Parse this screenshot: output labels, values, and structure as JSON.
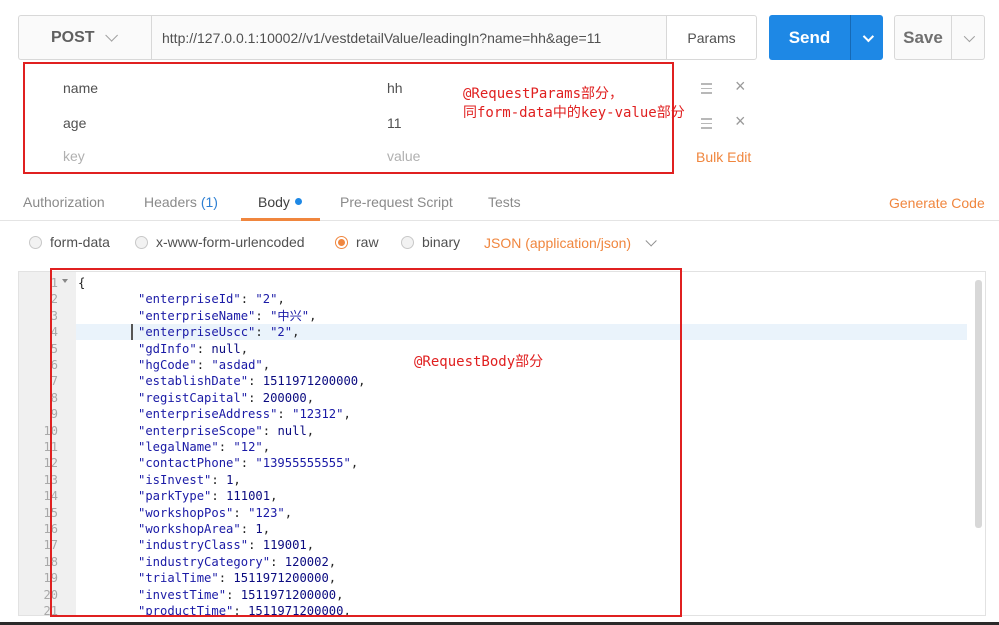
{
  "request": {
    "method": "POST",
    "url": "http://127.0.0.1:10002//v1/vestdetailValue/leadingIn?name=hh&age=11",
    "params_button": "Params",
    "send_button": "Send",
    "save_button": "Save"
  },
  "params": {
    "rows": [
      {
        "key": "name",
        "value": "hh"
      },
      {
        "key": "age",
        "value": "11"
      }
    ],
    "placeholder": {
      "key": "key",
      "value": "value"
    },
    "bulk_edit": "Bulk Edit"
  },
  "annotations": {
    "params_note_line1": "@RequestParams部分，",
    "params_note_line2": "同form-data中的key-value部分",
    "body_note": "@RequestBody部分"
  },
  "tabs": {
    "authorization": "Authorization",
    "headers": "Headers",
    "headers_count": "(1)",
    "body": "Body",
    "prerequest": "Pre-request Script",
    "tests": "Tests",
    "generate_code": "Generate Code",
    "active": "Body"
  },
  "body_options": {
    "form_data": "form-data",
    "urlencoded": "x-www-form-urlencoded",
    "raw": "raw",
    "binary": "binary",
    "selected": "raw",
    "content_type": "JSON (application/json)"
  },
  "editor": {
    "highlighted_line": 4,
    "lines": [
      {
        "n": "1",
        "key": "",
        "val": "{",
        "vtype": "punc"
      },
      {
        "n": "2",
        "key": "\"enterpriseId\"",
        "val": "\"2\"",
        "vtype": "str"
      },
      {
        "n": "3",
        "key": "\"enterpriseName\"",
        "val": "\"中兴\"",
        "vtype": "str"
      },
      {
        "n": "4",
        "key": "\"enterpriseUscc\"",
        "val": "\"2\"",
        "vtype": "str"
      },
      {
        "n": "5",
        "key": "\"gdInfo\"",
        "val": "null",
        "vtype": "num"
      },
      {
        "n": "6",
        "key": "\"hgCode\"",
        "val": "\"asdad\"",
        "vtype": "str"
      },
      {
        "n": "7",
        "key": "\"establishDate\"",
        "val": "1511971200000",
        "vtype": "num"
      },
      {
        "n": "8",
        "key": "\"registCapital\"",
        "val": "200000",
        "vtype": "num"
      },
      {
        "n": "9",
        "key": "\"enterpriseAddress\"",
        "val": "\"12312\"",
        "vtype": "str"
      },
      {
        "n": "10",
        "key": "\"enterpriseScope\"",
        "val": "null",
        "vtype": "num"
      },
      {
        "n": "11",
        "key": "\"legalName\"",
        "val": "\"12\"",
        "vtype": "str"
      },
      {
        "n": "12",
        "key": "\"contactPhone\"",
        "val": "\"13955555555\"",
        "vtype": "str"
      },
      {
        "n": "13",
        "key": "\"isInvest\"",
        "val": "1",
        "vtype": "num"
      },
      {
        "n": "14",
        "key": "\"parkType\"",
        "val": "111001",
        "vtype": "num"
      },
      {
        "n": "15",
        "key": "\"workshopPos\"",
        "val": "\"123\"",
        "vtype": "str"
      },
      {
        "n": "16",
        "key": "\"workshopArea\"",
        "val": "1",
        "vtype": "num"
      },
      {
        "n": "17",
        "key": "\"industryClass\"",
        "val": "119001",
        "vtype": "num"
      },
      {
        "n": "18",
        "key": "\"industryCategory\"",
        "val": "120002",
        "vtype": "num"
      },
      {
        "n": "19",
        "key": "\"trialTime\"",
        "val": "1511971200000",
        "vtype": "num"
      },
      {
        "n": "20",
        "key": "\"investTime\"",
        "val": "1511971200000",
        "vtype": "num"
      },
      {
        "n": "21",
        "key": "\"productTime\"",
        "val": "1511971200000",
        "vtype": "num"
      }
    ]
  },
  "colors": {
    "accent": "#f0863e",
    "send_blue": "#1e88e5",
    "annotation_red": "#e02020"
  }
}
